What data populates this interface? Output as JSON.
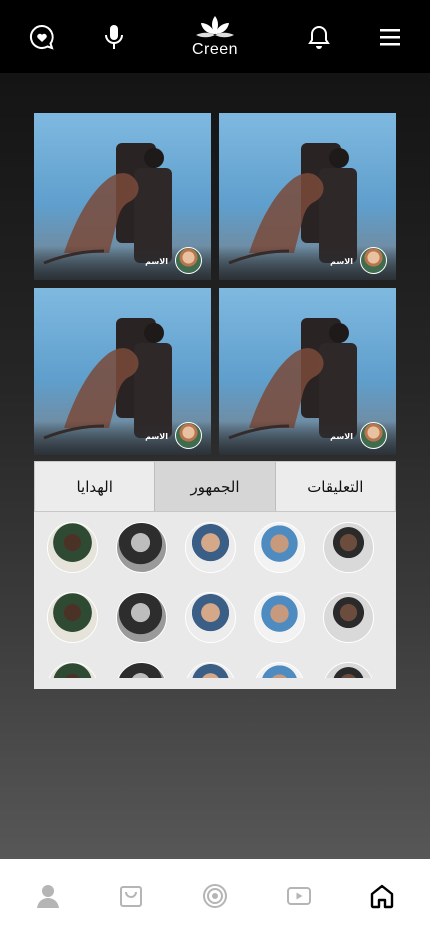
{
  "header": {
    "logo_text": "Creen",
    "icons": [
      "heart-chat-icon",
      "microphone-icon",
      "bell-icon",
      "menu-icon"
    ]
  },
  "participants": [
    {
      "name": "الاسم"
    },
    {
      "name": "الاسم"
    },
    {
      "name": "الاسم"
    },
    {
      "name": "الاسم"
    }
  ],
  "tabs": [
    {
      "label": "التعليقات",
      "active": false
    },
    {
      "label": "الجمهور",
      "active": true
    },
    {
      "label": "الهدايا",
      "active": false
    }
  ],
  "audience": {
    "rows": 3,
    "per_row": 5
  },
  "bottom_nav": [
    "home-icon",
    "video-icon",
    "target-icon",
    "bag-icon",
    "profile-icon"
  ],
  "colors": {
    "header_bg": "#000000",
    "tab_active_bg": "#d6d6d6",
    "panel_bg": "#e9e9e9",
    "nav_active": "#000000",
    "nav_inactive": "#b5b5b5"
  }
}
